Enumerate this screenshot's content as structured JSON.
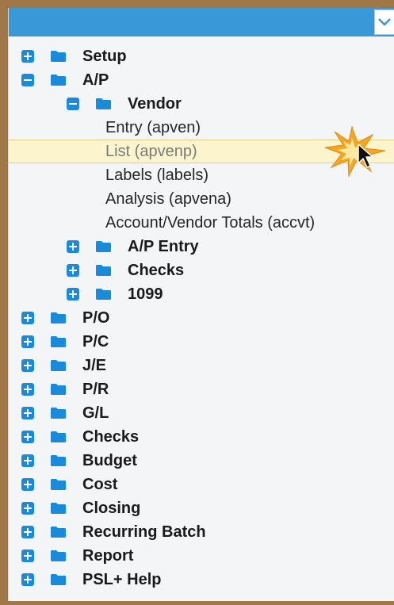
{
  "colors": {
    "accent": "#3998d8",
    "toggle": "#1a8adb",
    "folder": "#1a8adb",
    "selected_bg": "#fcf4cc",
    "frame": "#a07848"
  },
  "tree": [
    {
      "label": "Setup",
      "type": "folder",
      "state": "collapsed"
    },
    {
      "label": "A/P",
      "type": "folder",
      "state": "expanded"
    },
    {
      "label": "Vendor",
      "type": "folder",
      "state": "expanded"
    },
    {
      "label": "Entry (apven)",
      "type": "item"
    },
    {
      "label": "List (apvenp)",
      "type": "item",
      "selected": true
    },
    {
      "label": "Labels (labels)",
      "type": "item"
    },
    {
      "label": "Analysis (apvena)",
      "type": "item"
    },
    {
      "label": "Account/Vendor Totals (accvt)",
      "type": "item"
    },
    {
      "label": "A/P Entry",
      "type": "folder",
      "state": "collapsed"
    },
    {
      "label": "Checks",
      "type": "folder",
      "state": "collapsed"
    },
    {
      "label": "1099",
      "type": "folder",
      "state": "collapsed"
    },
    {
      "label": "P/O",
      "type": "folder",
      "state": "collapsed"
    },
    {
      "label": "P/C",
      "type": "folder",
      "state": "collapsed"
    },
    {
      "label": "J/E",
      "type": "folder",
      "state": "collapsed"
    },
    {
      "label": "P/R",
      "type": "folder",
      "state": "collapsed"
    },
    {
      "label": "G/L",
      "type": "folder",
      "state": "collapsed"
    },
    {
      "label": "Checks",
      "type": "folder",
      "state": "collapsed"
    },
    {
      "label": "Budget",
      "type": "folder",
      "state": "collapsed"
    },
    {
      "label": "Cost",
      "type": "folder",
      "state": "collapsed"
    },
    {
      "label": "Closing",
      "type": "folder",
      "state": "collapsed"
    },
    {
      "label": "Recurring Batch",
      "type": "folder",
      "state": "collapsed"
    },
    {
      "label": "Report",
      "type": "folder",
      "state": "collapsed"
    },
    {
      "label": "PSL+ Help",
      "type": "folder",
      "state": "collapsed"
    }
  ]
}
